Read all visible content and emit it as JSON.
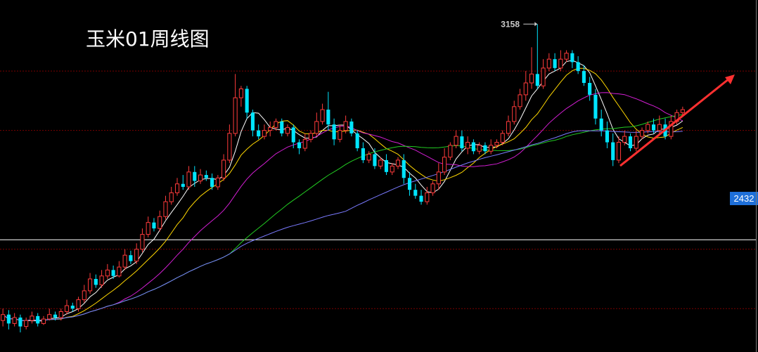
{
  "title": "玉米01周线图",
  "price_marker": "2432",
  "colors": {
    "background": "#000000",
    "up_candle": "#ff3b3b",
    "down_candle": "#00e5ff",
    "grid": "#7a0000",
    "ma5": "#ffffff",
    "ma10": "#ffd700",
    "ma20": "#d21ed2",
    "ma40": "#22cc22",
    "ma60": "#7a7aff",
    "price_line": "#ffffff",
    "arrow": "#ff3030"
  },
  "chart_data": {
    "type": "candlestick",
    "title": "玉米01周线图",
    "annotations": [
      {
        "text": "3158",
        "type": "high-marker"
      },
      {
        "text": "2432",
        "type": "current-price-label"
      }
    ],
    "ylim": [
      2080,
      3180
    ],
    "grid": true,
    "price_line": 2432,
    "trend_arrow": {
      "from": [
        236,
        2680
      ],
      "to": [
        256,
        2970
      ],
      "direction": "up"
    },
    "candles": [
      [
        2160,
        2180,
        2140,
        2200
      ],
      [
        2180,
        2150,
        2130,
        2195
      ],
      [
        2150,
        2170,
        2140,
        2185
      ],
      [
        2170,
        2140,
        2120,
        2180
      ],
      [
        2140,
        2160,
        2130,
        2170
      ],
      [
        2160,
        2175,
        2150,
        2190
      ],
      [
        2175,
        2150,
        2140,
        2185
      ],
      [
        2150,
        2165,
        2145,
        2175
      ],
      [
        2165,
        2180,
        2160,
        2200
      ],
      [
        2180,
        2170,
        2160,
        2190
      ],
      [
        2170,
        2190,
        2160,
        2200
      ],
      [
        2190,
        2210,
        2180,
        2230
      ],
      [
        2210,
        2200,
        2190,
        2220
      ],
      [
        2200,
        2230,
        2190,
        2240
      ],
      [
        2230,
        2260,
        2220,
        2280
      ],
      [
        2260,
        2300,
        2250,
        2320
      ],
      [
        2300,
        2280,
        2270,
        2315
      ],
      [
        2280,
        2310,
        2270,
        2330
      ],
      [
        2310,
        2330,
        2300,
        2350
      ],
      [
        2330,
        2310,
        2300,
        2345
      ],
      [
        2310,
        2340,
        2305,
        2360
      ],
      [
        2340,
        2380,
        2330,
        2400
      ],
      [
        2380,
        2360,
        2350,
        2395
      ],
      [
        2360,
        2400,
        2350,
        2420
      ],
      [
        2400,
        2450,
        2390,
        2470
      ],
      [
        2450,
        2490,
        2440,
        2510
      ],
      [
        2490,
        2470,
        2460,
        2505
      ],
      [
        2470,
        2510,
        2460,
        2530
      ],
      [
        2510,
        2560,
        2500,
        2580
      ],
      [
        2560,
        2590,
        2550,
        2610
      ],
      [
        2590,
        2620,
        2580,
        2640
      ],
      [
        2620,
        2610,
        2600,
        2650
      ],
      [
        2610,
        2660,
        2600,
        2680
      ],
      [
        2660,
        2630,
        2610,
        2680
      ],
      [
        2630,
        2650,
        2620,
        2670
      ],
      [
        2650,
        2640,
        2630,
        2665
      ],
      [
        2640,
        2610,
        2600,
        2655
      ],
      [
        2610,
        2640,
        2600,
        2650
      ],
      [
        2640,
        2700,
        2630,
        2720
      ],
      [
        2700,
        2790,
        2690,
        2820
      ],
      [
        2790,
        2910,
        2780,
        2990
      ],
      [
        2910,
        2940,
        2880,
        2950
      ],
      [
        2940,
        2860,
        2840,
        2950
      ],
      [
        2860,
        2800,
        2780,
        2870
      ],
      [
        2800,
        2780,
        2770,
        2820
      ],
      [
        2780,
        2800,
        2770,
        2820
      ],
      [
        2800,
        2810,
        2780,
        2830
      ],
      [
        2810,
        2830,
        2800,
        2840
      ],
      [
        2830,
        2790,
        2780,
        2840
      ],
      [
        2790,
        2810,
        2780,
        2820
      ],
      [
        2810,
        2760,
        2740,
        2820
      ],
      [
        2760,
        2740,
        2720,
        2770
      ],
      [
        2740,
        2770,
        2730,
        2790
      ],
      [
        2770,
        2790,
        2760,
        2800
      ],
      [
        2790,
        2830,
        2780,
        2860
      ],
      [
        2830,
        2870,
        2820,
        2890
      ],
      [
        2870,
        2820,
        2800,
        2930
      ],
      [
        2820,
        2770,
        2750,
        2840
      ],
      [
        2770,
        2800,
        2760,
        2820
      ],
      [
        2800,
        2830,
        2790,
        2850
      ],
      [
        2830,
        2790,
        2780,
        2840
      ],
      [
        2790,
        2740,
        2730,
        2800
      ],
      [
        2740,
        2700,
        2690,
        2760
      ],
      [
        2700,
        2720,
        2690,
        2730
      ],
      [
        2720,
        2680,
        2670,
        2740
      ],
      [
        2680,
        2700,
        2670,
        2710
      ],
      [
        2700,
        2660,
        2650,
        2720
      ],
      [
        2660,
        2680,
        2650,
        2690
      ],
      [
        2680,
        2700,
        2670,
        2710
      ],
      [
        2700,
        2640,
        2620,
        2720
      ],
      [
        2640,
        2600,
        2580,
        2660
      ],
      [
        2600,
        2580,
        2570,
        2620
      ],
      [
        2580,
        2560,
        2550,
        2600
      ],
      [
        2560,
        2590,
        2550,
        2610
      ],
      [
        2590,
        2620,
        2580,
        2630
      ],
      [
        2620,
        2660,
        2600,
        2690
      ],
      [
        2660,
        2710,
        2650,
        2740
      ],
      [
        2710,
        2750,
        2700,
        2760
      ],
      [
        2750,
        2780,
        2740,
        2800
      ],
      [
        2780,
        2740,
        2730,
        2800
      ],
      [
        2740,
        2760,
        2720,
        2780
      ],
      [
        2760,
        2730,
        2720,
        2770
      ],
      [
        2730,
        2750,
        2720,
        2760
      ],
      [
        2750,
        2730,
        2720,
        2760
      ],
      [
        2730,
        2750,
        2720,
        2770
      ],
      [
        2750,
        2760,
        2740,
        2770
      ],
      [
        2760,
        2790,
        2750,
        2800
      ],
      [
        2790,
        2830,
        2780,
        2850
      ],
      [
        2830,
        2880,
        2820,
        2900
      ],
      [
        2880,
        2920,
        2870,
        2940
      ],
      [
        2920,
        2960,
        2900,
        3000
      ],
      [
        2960,
        2990,
        2940,
        3080
      ],
      [
        2990,
        2950,
        2940,
        3158
      ],
      [
        2950,
        3010,
        2940,
        3040
      ],
      [
        3010,
        3040,
        3000,
        3060
      ],
      [
        3040,
        3010,
        3000,
        3060
      ],
      [
        3010,
        3040,
        3000,
        3070
      ],
      [
        3040,
        3060,
        3030,
        3070
      ],
      [
        3060,
        3030,
        3010,
        3070
      ],
      [
        3030,
        3000,
        2990,
        3050
      ],
      [
        3000,
        2960,
        2950,
        3020
      ],
      [
        2960,
        2920,
        2900,
        2980
      ],
      [
        2920,
        2840,
        2820,
        2940
      ],
      [
        2840,
        2800,
        2780,
        2870
      ],
      [
        2800,
        2760,
        2740,
        2830
      ],
      [
        2760,
        2700,
        2680,
        2790
      ],
      [
        2700,
        2760,
        2690,
        2780
      ],
      [
        2760,
        2780,
        2750,
        2800
      ],
      [
        2780,
        2740,
        2730,
        2790
      ],
      [
        2740,
        2780,
        2730,
        2800
      ],
      [
        2780,
        2800,
        2770,
        2810
      ],
      [
        2800,
        2820,
        2790,
        2830
      ],
      [
        2820,
        2800,
        2790,
        2840
      ],
      [
        2800,
        2820,
        2790,
        2850
      ],
      [
        2820,
        2780,
        2770,
        2840
      ],
      [
        2780,
        2830,
        2770,
        2850
      ],
      [
        2830,
        2860,
        2820,
        2870
      ],
      [
        2860,
        2870,
        2850,
        2880
      ]
    ]
  }
}
